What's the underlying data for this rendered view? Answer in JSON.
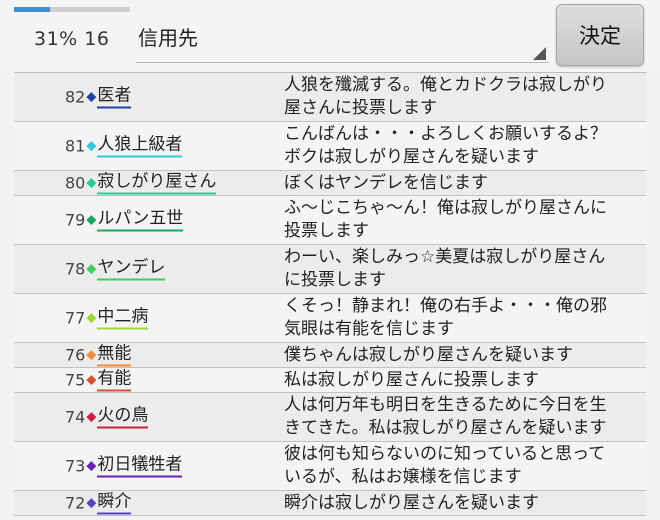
{
  "header": {
    "progress_percent": 31,
    "progress_label": "31%",
    "count": "16",
    "select_value": "信用先",
    "decide_label": "決定"
  },
  "rows": [
    {
      "num": "82",
      "name": "医者",
      "color": "#1f3fa8",
      "lines": [
        "人狼を殲滅する。俺とカドクラは寂しがり",
        "屋さんに投票します"
      ]
    },
    {
      "num": "81",
      "name": "人狼上級者",
      "color": "#2fc8dc",
      "lines": [
        "こんばんは・・・よろしくお願いするよ？",
        "ボクは寂しがり屋さんを疑います"
      ]
    },
    {
      "num": "80",
      "name": "寂しがり屋さん",
      "color": "#1fcf9a",
      "lines": [
        "ぼくはヤンデレを信じます"
      ]
    },
    {
      "num": "79",
      "name": "ルパン五世",
      "color": "#16a860",
      "lines": [
        "ふ～じこちゃ～ん！俺は寂しがり屋さんに",
        "投票します"
      ]
    },
    {
      "num": "78",
      "name": "ヤンデレ",
      "color": "#3ccf5a",
      "lines": [
        "わーい、楽しみっ☆美夏は寂しがり屋さん",
        "に投票します"
      ]
    },
    {
      "num": "77",
      "name": "中二病",
      "color": "#9bd934",
      "lines": [
        "くそっ！静まれ！俺の右手よ・・・俺の邪",
        "気眼は有能を信じます"
      ]
    },
    {
      "num": "76",
      "name": "無能",
      "color": "#f08a3a",
      "lines": [
        "僕ちゃんは寂しがり屋さんを疑います"
      ]
    },
    {
      "num": "75",
      "name": "有能",
      "color": "#e0502a",
      "lines": [
        "私は寂しがり屋さんに投票します"
      ]
    },
    {
      "num": "74",
      "name": "火の鳥",
      "color": "#d11e3a",
      "lines": [
        "人は何万年も明日を生きるために今日を生",
        "きてきた。私は寂しがり屋さんを疑います"
      ]
    },
    {
      "num": "73",
      "name": "初日犠牲者",
      "color": "#6a1fb0",
      "lines": [
        "彼は何も知らないのに知っていると思って",
        "いるが、私はお嬢様を信じます"
      ]
    },
    {
      "num": "72",
      "name": "瞬介",
      "color": "#5a42c8",
      "lines": [
        "瞬介は寂しがり屋さんを疑います"
      ]
    }
  ]
}
